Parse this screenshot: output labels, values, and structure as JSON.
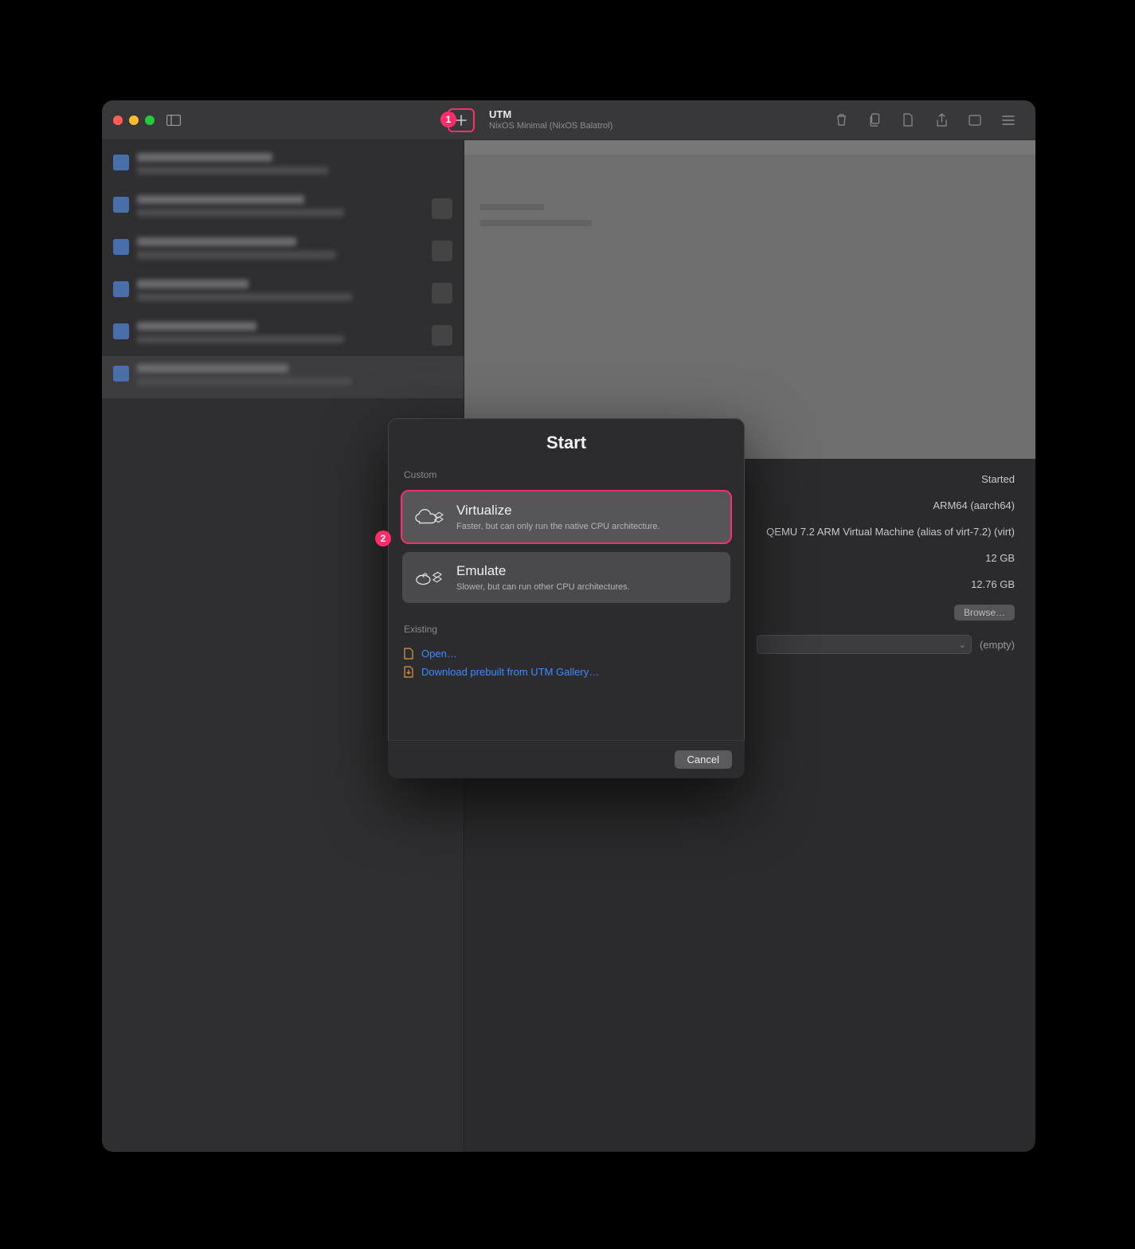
{
  "window": {
    "app_title": "UTM",
    "subtitle": "NixOS Minimal (NixOS Balatrol)"
  },
  "toolbar_icons": {
    "sidebar_toggle": "sidebar-toggle-icon",
    "add": "plus-icon",
    "trash": "trash-icon",
    "clone": "clone-icon",
    "doc": "document-icon",
    "share": "share-icon",
    "window": "window-icon",
    "menu": "menu-icon"
  },
  "annotations": {
    "badge1": "1",
    "badge2": "2"
  },
  "vm_info": {
    "status": "Started",
    "arch": "ARM64 (aarch64)",
    "machine": "QEMU 7.2 ARM Virtual Machine (alias of virt-7.2) (virt)",
    "memory": "12 GB",
    "disk": "12.76 GB",
    "browse_label": "Browse…",
    "drive_empty": "(empty)"
  },
  "modal": {
    "title": "Start",
    "section_custom": "Custom",
    "virtualize": {
      "title": "Virtualize",
      "desc": "Faster, but can only run the native CPU architecture."
    },
    "emulate": {
      "title": "Emulate",
      "desc": "Slower, but can run other CPU architectures."
    },
    "section_existing": "Existing",
    "open_label": "Open…",
    "download_label": "Download prebuilt from UTM Gallery…",
    "cancel_label": "Cancel"
  }
}
